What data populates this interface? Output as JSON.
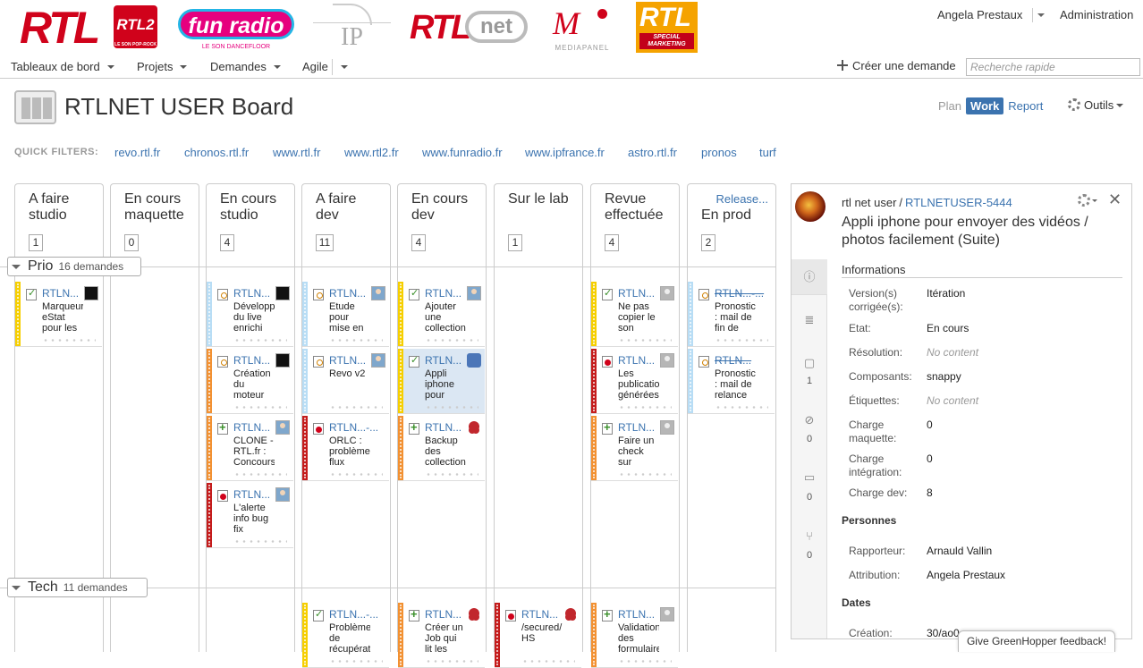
{
  "logos": {
    "rtl": "RTL",
    "rtl2": "RTL2",
    "rtl2_tagline": "LE SON POP-ROCK",
    "funradio": "fun radio",
    "funradio_tagline": "LE SON DANCEFLOOR",
    "ip": "IP",
    "rtlnet_rtl": "RTL",
    "rtlnet_net": "net",
    "mediapanel": "MEDIAPANEL",
    "special_rtl": "RTL",
    "special_marketing": "SPECIAL MARKETING"
  },
  "header": {
    "user": "Angela Prestaux",
    "admin": "Administration"
  },
  "nav": {
    "items": [
      "Tableaux de bord",
      "Projets",
      "Demandes",
      "Agile"
    ],
    "create": "Créer une demande",
    "search_placeholder": "Recherche rapide"
  },
  "board": {
    "title": "RTLNET USER Board",
    "modes": {
      "plan": "Plan",
      "work": "Work",
      "report": "Report"
    },
    "tools": "Outils",
    "quick_filters_label": "QUICK FILTERS:",
    "quick_filters": [
      "revo.rtl.fr",
      "chronos.rtl.fr",
      "www.rtl.fr",
      "www.rtl2.fr",
      "www.funradio.fr",
      "www.ipfrance.fr",
      "astro.rtl.fr",
      "pronos",
      "turf"
    ],
    "columns": [
      {
        "line1": "A faire",
        "line2": "studio",
        "count": "1"
      },
      {
        "line1": "En cours",
        "line2": "maquette",
        "count": "0"
      },
      {
        "line1": "En cours",
        "line2": "studio",
        "count": "4"
      },
      {
        "line1": "A faire",
        "line2": "dev",
        "count": "11"
      },
      {
        "line1": "En cours",
        "line2": "dev",
        "count": "4"
      },
      {
        "line1": "Sur le lab",
        "line2": "",
        "count": "1"
      },
      {
        "line1": "Revue",
        "line2": "effectuée",
        "count": "4"
      },
      {
        "line1": "En prod",
        "line2": "",
        "count": "2",
        "release": "Release..."
      }
    ],
    "swimlanes": [
      {
        "name": "Prio",
        "count": "16 demandes"
      },
      {
        "name": "Tech",
        "count": "11 demandes"
      }
    ],
    "cards": [
      {
        "key": "RTLN...",
        "summary": "Marqueur eStat pour les",
        "type": "story",
        "color": "#f6cf00",
        "avatar": "black"
      },
      {
        "key": "RTLN...",
        "summary": "Développement du live enrichi",
        "type": "task",
        "color": "#b8ddf5",
        "avatar": "black"
      },
      {
        "key": "RTLN...",
        "summary": "Création du moteur",
        "type": "task",
        "color": "#f29132",
        "avatar": "black"
      },
      {
        "key": "RTLN...",
        "summary": "CLONE - RTL.fr : Concours",
        "type": "newf",
        "color": "#f29132",
        "avatar": "person"
      },
      {
        "key": "RTLN...",
        "summary": "L'alerte info bug fix",
        "type": "bug",
        "color": "#c41c1c",
        "avatar": "person"
      },
      {
        "key": "RTLN...",
        "summary": "Etude pour mise en",
        "type": "task",
        "color": "#b8ddf5",
        "avatar": "person"
      },
      {
        "key": "RTLN...",
        "summary": "Revo v2",
        "type": "task",
        "color": "#b8ddf5",
        "avatar": "person"
      },
      {
        "key": "RTLN...-...",
        "summary": "ORLC : problème flux",
        "type": "bug",
        "color": "#c41c1c",
        "avatar": "none"
      },
      {
        "key": "RTLN...",
        "summary": "Ajouter une collection",
        "type": "story",
        "color": "#f6cf00",
        "avatar": "person"
      },
      {
        "key": "RTLN...",
        "summary": "Appli iphone pour",
        "type": "story",
        "color": "#f6cf00",
        "avatar": "stitch"
      },
      {
        "key": "RTLN...",
        "summary": "Backup des collection",
        "type": "newf",
        "color": "#f29132",
        "avatar": "octo"
      },
      {
        "key": "RTLN...",
        "summary": "Ne pas copier le son",
        "type": "story",
        "color": "#f6cf00",
        "avatar": "grey"
      },
      {
        "key": "RTLN...",
        "summary": "Les publications générées",
        "type": "bug",
        "color": "#c41c1c",
        "avatar": "grey"
      },
      {
        "key": "RTLN...",
        "summary": "Faire un check sur",
        "type": "newf",
        "color": "#f29132",
        "avatar": "grey"
      },
      {
        "key": "RTLN...-...",
        "summary": "Pronostics : mail de fin de manche",
        "type": "task",
        "color": "#b8ddf5",
        "avatar": "none"
      },
      {
        "key": "RTLN...",
        "summary": "Pronostic : mail de relance",
        "type": "task",
        "color": "#b8ddf5",
        "avatar": "none"
      },
      {
        "key": "RTLN...-...",
        "summary": "Problème de récupération",
        "type": "story",
        "color": "#f6cf00",
        "avatar": "none"
      },
      {
        "key": "RTLN...",
        "summary": "Créer un Job qui lit les",
        "type": "newf",
        "color": "#f29132",
        "avatar": "octo"
      },
      {
        "key": "RTLN...",
        "summary": "/secured/ HS",
        "type": "bug",
        "color": "#c41c1c",
        "avatar": "octo"
      },
      {
        "key": "RTLN...",
        "summary": "Validation des formulaires",
        "type": "newf",
        "color": "#f29132",
        "avatar": "grey"
      }
    ]
  },
  "detail": {
    "project": "rtl net user",
    "separator": "/",
    "key": "RTLNETUSER-5444",
    "summary": "Appli iphone pour envoyer des vidéos / photos facilement (Suite)",
    "sections": {
      "info": "Informations",
      "people": "Personnes",
      "dates": "Dates"
    },
    "fields": [
      {
        "label": "Version(s) corrigée(s):",
        "value": "Itération"
      },
      {
        "label": "Etat:",
        "value": "En cours"
      },
      {
        "label": "Résolution:",
        "value": "No content"
      },
      {
        "label": "Composants:",
        "value": "snappy"
      },
      {
        "label": "Étiquettes:",
        "value": "No content"
      },
      {
        "label": "Charge maquette:",
        "value": "0"
      },
      {
        "label": "Charge intégration:",
        "value": "0"
      },
      {
        "label": "Charge dev:",
        "value": "8"
      }
    ],
    "people": [
      {
        "label": "Rapporteur:",
        "value": "Arnauld Vallin"
      },
      {
        "label": "Attribution:",
        "value": "Angela Prestaux"
      }
    ],
    "dates": [
      {
        "label": "Création:",
        "value": "30/ao0"
      }
    ],
    "rail_counts": {
      "comments": "1",
      "attachments": "0",
      "subtasks": "0",
      "commits": "0"
    }
  },
  "feedback": "Give GreenHopper feedback!"
}
